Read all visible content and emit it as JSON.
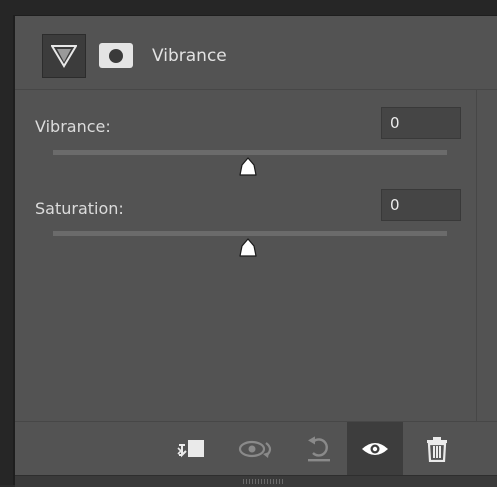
{
  "panel": {
    "title": "Vibrance",
    "adjustment_icon": "vibrance-triangle-icon",
    "mask_icon": "layer-mask-icon"
  },
  "controls": [
    {
      "label": "Vibrance:",
      "value": "0",
      "slider_fraction": 0.5
    },
    {
      "label": "Saturation:",
      "value": "0",
      "slider_fraction": 0.5
    }
  ],
  "toolbar": {
    "buttons": [
      {
        "icon": "clip-to-layer-icon"
      },
      {
        "icon": "view-previous-state-icon"
      },
      {
        "icon": "reset-icon"
      },
      {
        "icon": "toggle-visibility-icon",
        "active": true
      },
      {
        "icon": "trash-icon"
      }
    ]
  },
  "colors": {
    "panel_bg": "#535353",
    "icon_color": "#e6e6e6",
    "disabled_icon": "#8a8a8a"
  }
}
